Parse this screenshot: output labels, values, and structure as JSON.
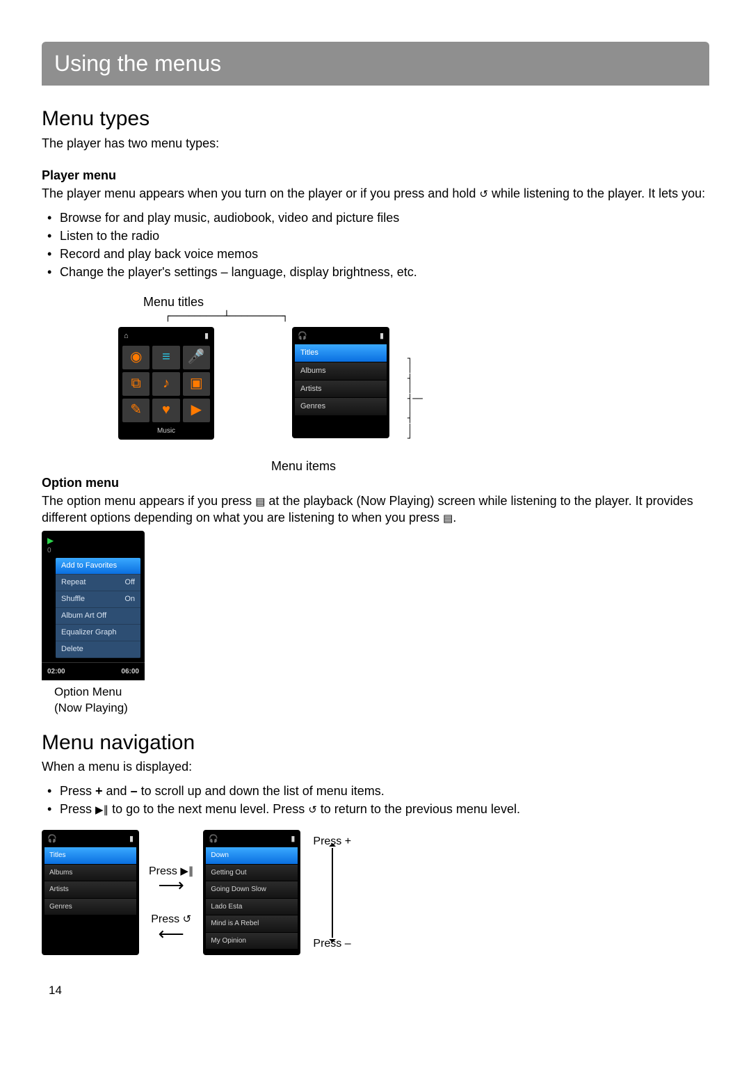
{
  "header": {
    "title": "Using the menus"
  },
  "section1": {
    "heading": "Menu types",
    "intro": "The player has two menu types:"
  },
  "playerMenu": {
    "title": "Player menu",
    "para_a": "The player menu appears when you turn on the player or if you press and hold ",
    "para_b": " while listening to the player. It lets you:",
    "bullets": [
      "Browse for and play music, audiobook, video and picture files",
      "Listen to the radio",
      "Record and play back voice memos",
      "Change the player's settings – language, display brightness, etc."
    ]
  },
  "figure1": {
    "label_titles": "Menu titles",
    "label_items": "Menu items",
    "grid_caption": "Music",
    "list_items": [
      "Titles",
      "Albums",
      "Artists",
      "Genres"
    ]
  },
  "optionMenu": {
    "title": "Option menu",
    "para_a": "The option menu appears if you press ",
    "para_b": " at the playback (Now Playing) screen while listening to the player. It provides different options depending on what you are listening to when you press ",
    "para_c": ".",
    "panel": {
      "rows": [
        {
          "label": "Add to Favorites",
          "value": ""
        },
        {
          "label": "Repeat",
          "value": "Off"
        },
        {
          "label": "Shuffle",
          "value": "On"
        },
        {
          "label": "Album Art Off",
          "value": ""
        },
        {
          "label": "Equalizer Graph",
          "value": ""
        },
        {
          "label": "Delete",
          "value": ""
        }
      ],
      "time_left": "02:00",
      "time_right": "06:00"
    },
    "caption_line1": "Option Menu",
    "caption_line2": "(Now Playing)"
  },
  "section2": {
    "heading": "Menu navigation",
    "intro": "When a menu is displayed:",
    "bullet1_a": "Press ",
    "bullet1_plus": "+",
    "bullet1_b": " and ",
    "bullet1_minus": "–",
    "bullet1_c": " to scroll up and down the list of menu items.",
    "bullet2_a": "Press ",
    "bullet2_b": " to go to the next menu level. Press ",
    "bullet2_c": " to return to the previous menu level."
  },
  "navFigure": {
    "left_list": [
      "Titles",
      "Albums",
      "Artists",
      "Genres"
    ],
    "press_forward": "Press ",
    "press_back": "Press ",
    "right_list": [
      "Down",
      "Getting Out",
      "Going Down Slow",
      "Lado Esta",
      "Mind is A Rebel",
      "My Opinion"
    ],
    "press_plus": "Press +",
    "press_minus": "Press –"
  },
  "page": {
    "number": "14"
  },
  "icons": {
    "back": "↺",
    "menu": "▤",
    "playpause": "▶∥",
    "headphones": "🎧",
    "battery": "▮",
    "home": "⌂"
  }
}
